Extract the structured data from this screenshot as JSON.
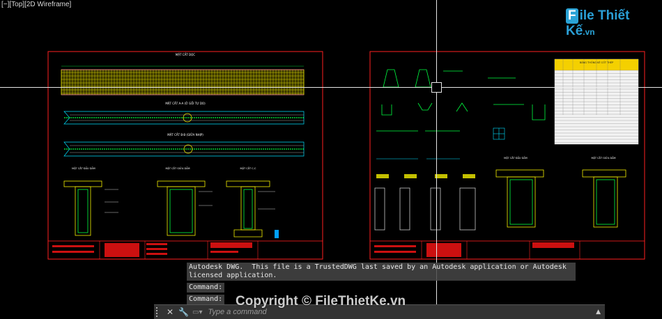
{
  "viewport": {
    "label": "[−][Top][2D Wireframe]"
  },
  "logo": {
    "box_text": "F",
    "rest_text": "ile Thiết Kế",
    "suffix": ".vn"
  },
  "sheet_left": {
    "title_main": "MẶT CẮT DỌC",
    "section_aa": "MẶT CẮT A-A (Ở GỐI TỰ DO)",
    "section_bb": "MẶT CẮT B-B (GIỮA NHỊP)",
    "detail_1": "MẶT CẮT ĐẦU DẦM",
    "detail_2": "MẶT CẮT GIỮA DẦM",
    "detail_3": "MẶT CẮT C-C",
    "title_block": "BỐ TRÍ CỐT THÉP DẦM"
  },
  "sheet_right": {
    "table_title": "BẢNG THỐNG KÊ CỐT THÉP",
    "detail_1": "MẶT CẮT ĐẦU DẦM",
    "detail_2": "MẶT CẮT GIỮA DẦM",
    "title_block": "CHI TIẾT CỐT THÉP"
  },
  "command_history": {
    "line1": "Autodesk DWG.  This file is a TrustedDWG last saved by an Autodesk application or Autodesk licensed application.",
    "line2": "Command:",
    "line3": "Command:"
  },
  "command_bar": {
    "placeholder": "Type a command",
    "close_icon": "close-icon",
    "wrench_icon": "wrench-icon",
    "prompt_icon": "prompt-icon",
    "expand_icon": "chevron-up-icon"
  },
  "watermark": "Copyright © FileThietKe.vn",
  "colors": {
    "frame": "#ff2020",
    "rebar_green": "#00ff40",
    "rebar_yellow": "#f4f000",
    "cyan": "#00e0ff",
    "magenta": "#ff40ff",
    "background": "#000000"
  }
}
